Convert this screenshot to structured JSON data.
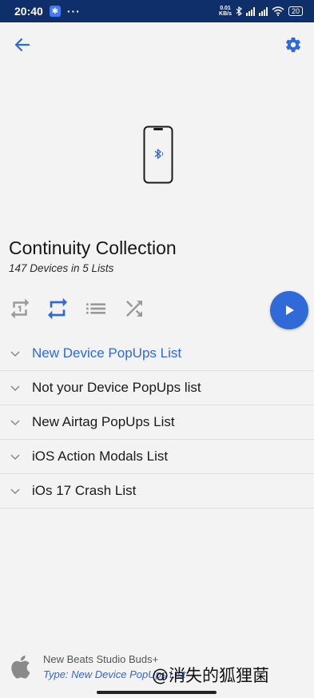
{
  "status_bar": {
    "time": "20:40",
    "bt_badge": "✱",
    "dots": "···",
    "speed_value": "0.01",
    "speed_unit": "KB/s",
    "battery": "20"
  },
  "header": {
    "back_icon": "arrow-left",
    "settings_icon": "gear"
  },
  "collection": {
    "title": "Continuity Collection",
    "subtitle": "147 Devices in 5 Lists"
  },
  "controls": {
    "repeat_one": "repeat-one-icon",
    "repeat": "repeat-icon",
    "list": "list-icon",
    "shuffle": "shuffle-icon",
    "play": "play-icon"
  },
  "colors": {
    "accent": "#2f6ad8",
    "status_bar": "#0f2f6a",
    "background": "#f3f3f3"
  },
  "lists": [
    {
      "label": "New Device PopUps List",
      "active": true
    },
    {
      "label": "Not your Device PopUps list",
      "active": false
    },
    {
      "label": "New Airtag PopUps List",
      "active": false
    },
    {
      "label": "iOS Action Modals List",
      "active": false
    },
    {
      "label": "iOs 17 Crash List",
      "active": false
    }
  ],
  "now_playing": {
    "name": "New Beats Studio Buds+",
    "type": "Type: New Device PopUps List"
  },
  "watermark": "@消失的狐狸菌"
}
